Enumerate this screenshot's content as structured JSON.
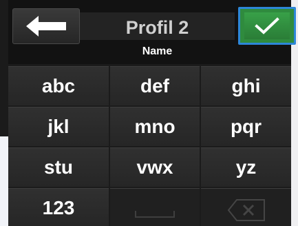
{
  "header": {
    "title": "Profil 2",
    "subtitle": "Name",
    "back_icon": "arrow-left-icon",
    "confirm_icon": "checkmark-icon"
  },
  "keypad": {
    "keys": [
      "abc",
      "def",
      "ghi",
      "jkl",
      "mno",
      "pqr",
      "stu",
      "vwx",
      "yz",
      "123"
    ],
    "space_icon": "space-icon",
    "backspace_icon": "backspace-icon"
  },
  "colors": {
    "background": "#1b1b1b",
    "key": "#2b2b2b",
    "confirm": "#2f8b3e",
    "confirm_border": "#2d87d8",
    "text": "#ffffff",
    "title": "#d0d0d0"
  }
}
